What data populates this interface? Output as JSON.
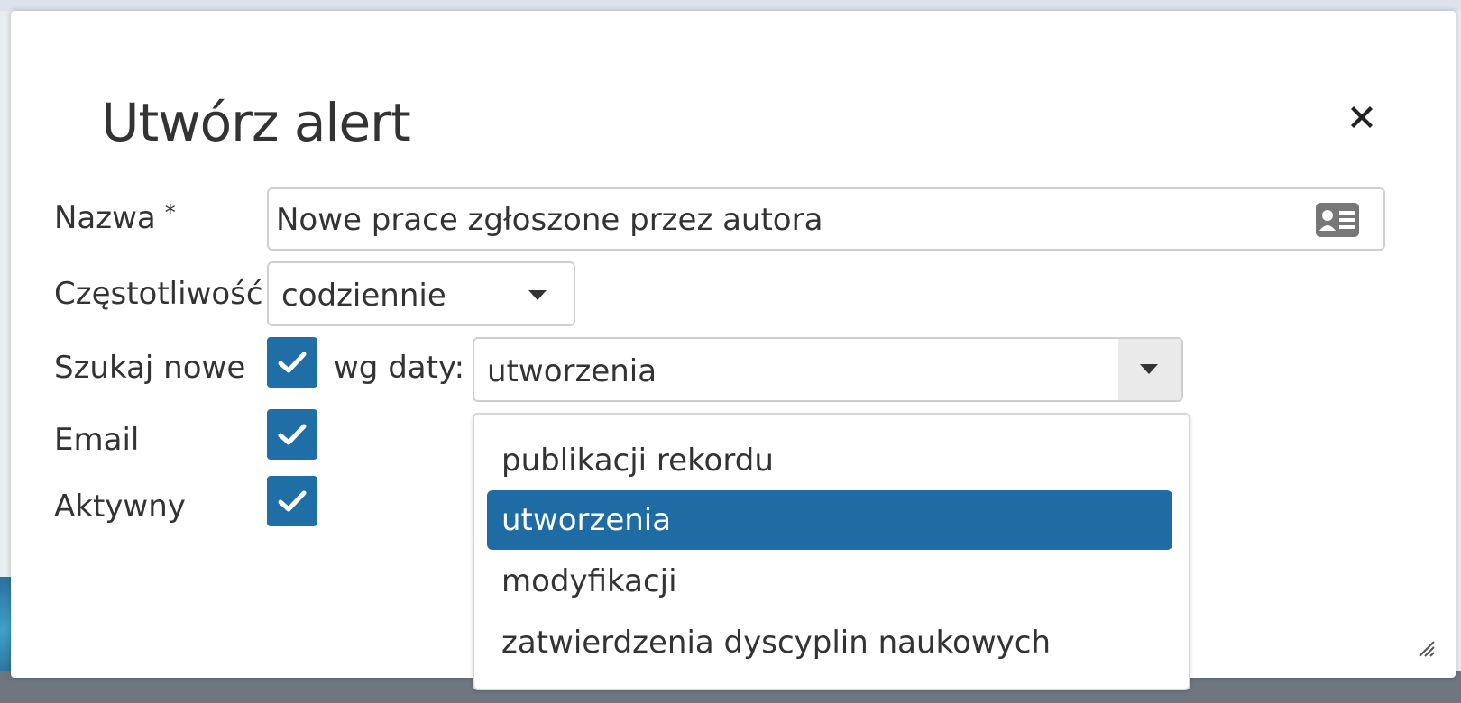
{
  "modal": {
    "title": "Utwórz alert",
    "close_icon": "close-icon"
  },
  "form": {
    "name": {
      "label": "Nazwa",
      "required_mark": "*",
      "value": "Nowe prace zgłoszone przez autora",
      "icon": "contact-card-icon"
    },
    "frequency": {
      "label": "Częstotliwość",
      "value": "codziennie"
    },
    "search_new": {
      "label": "Szukaj nowe",
      "checked": true,
      "by_date_label": "wg daty:",
      "date_value": "utworzenia"
    },
    "email": {
      "label": "Email",
      "checked": true
    },
    "active": {
      "label": "Aktywny",
      "checked": true
    }
  },
  "date_dropdown": {
    "options": [
      "publikacji rekordu",
      "utworzenia",
      "modyfikacji",
      "zatwierdzenia dyscyplin naukowych"
    ],
    "selected_index": 1
  },
  "colors": {
    "accent": "#1f6fa6",
    "selected_option_bg": "#1f6ca4",
    "text": "#333333"
  }
}
